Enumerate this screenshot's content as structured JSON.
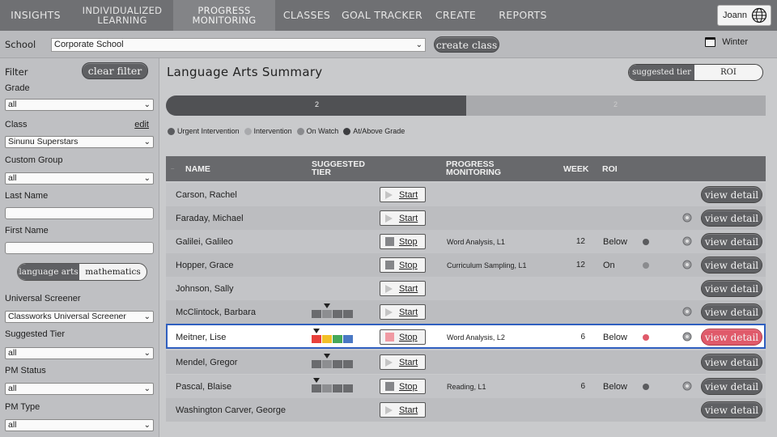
{
  "nav": {
    "items": [
      {
        "label": "INSIGHTS"
      },
      {
        "label_line1": "INDIVIDUALIZED",
        "label_line2": "LEARNING"
      },
      {
        "label_line1": "PROGRESS",
        "label_line2": "MONITORING"
      },
      {
        "label": "CLASSES"
      },
      {
        "label": "GOAL TRACKER"
      },
      {
        "label": "CREATE"
      },
      {
        "label": "REPORTS"
      }
    ],
    "active": "PROGRESS MONITORING",
    "user": "Joann"
  },
  "school_bar": {
    "label": "School",
    "selected": "Corporate School",
    "create_class_label": "create class",
    "season": "Winter"
  },
  "filter": {
    "title": "Filter",
    "clear_label": "clear filter",
    "grade_label": "Grade",
    "grade_value": "all",
    "class_label": "Class",
    "edit_label": "edit",
    "class_value": "Sinunu Superstars",
    "custom_group_label": "Custom Group",
    "custom_group_value": "all",
    "last_name_label": "Last Name",
    "last_name_value": "",
    "first_name_label": "First Name",
    "first_name_value": "",
    "subject_tabs": [
      "language arts",
      "mathematics"
    ],
    "subject_active": "language arts",
    "screener_label": "Universal Screener",
    "screener_value": "Classworks Universal Screener",
    "tier_label": "Suggested Tier",
    "tier_value": "all",
    "pm_status_label": "PM Status",
    "pm_status_value": "all",
    "pm_type_label": "PM Type",
    "pm_type_value": "all"
  },
  "summary": {
    "title": "Language Arts Summary",
    "toggle": [
      "suggested tier",
      "ROI"
    ],
    "toggle_active": "suggested tier",
    "progress_left_label": "2",
    "progress_right_label": "2",
    "progress_fraction": 0.5,
    "legend": [
      {
        "label": "Urgent Intervention",
        "color": "#5b5c5f"
      },
      {
        "label": "Intervention",
        "color": "#a9aaad"
      },
      {
        "label": "On Watch",
        "color": "#8a8b8e"
      },
      {
        "label": "At/Above Grade",
        "color": "#3c3d40"
      }
    ]
  },
  "table": {
    "headers": {
      "name": "NAME",
      "tier_line1": "SUGGESTED",
      "tier_line2": "TIER",
      "pm_line1": "PROGRESS",
      "pm_line2": "MONITORING",
      "week": "WEEK",
      "roi": "ROI"
    },
    "detail_label": "view detail",
    "rows": [
      {
        "name": "Carson, Rachel",
        "action": "Start",
        "pm": "",
        "week": "",
        "roi": ""
      },
      {
        "name": "Faraday, Michael",
        "action": "Start",
        "pm": "",
        "week": "",
        "roi": ""
      },
      {
        "name": "Galilei, Galileo",
        "action": "Stop",
        "pm": "Word Analysis, L1",
        "week": "12",
        "roi": "Below"
      },
      {
        "name": "Hopper, Grace",
        "action": "Stop",
        "pm": "Curriculum Sampling, L1",
        "week": "12",
        "roi": "On"
      },
      {
        "name": "Johnson, Sally",
        "action": "Start",
        "pm": "",
        "week": "",
        "roi": ""
      },
      {
        "name": "McClintock, Barbara",
        "action": "Start",
        "pm": "",
        "week": "",
        "roi": ""
      },
      {
        "name": "Meitner, Lise",
        "action": "Stop",
        "pm": "Word Analysis, L2",
        "week": "6",
        "roi": "Below"
      },
      {
        "name": "Mendel, Gregor",
        "action": "Start",
        "pm": "",
        "week": "",
        "roi": ""
      },
      {
        "name": "Pascal, Blaise",
        "action": "Stop",
        "pm": "Reading, L1",
        "week": "6",
        "roi": "Below"
      },
      {
        "name": "Washington Carver, George",
        "action": "Start",
        "pm": "",
        "week": "",
        "roi": ""
      }
    ]
  },
  "colors": {
    "nav_bg": "#6f7073",
    "highlight_border": "#2f5fbf",
    "alert_red": "#e05a6a",
    "tier_red": "#e8413c",
    "tier_yellow": "#f2c027",
    "tier_green": "#46a85a",
    "tier_blue": "#4a78c4"
  }
}
